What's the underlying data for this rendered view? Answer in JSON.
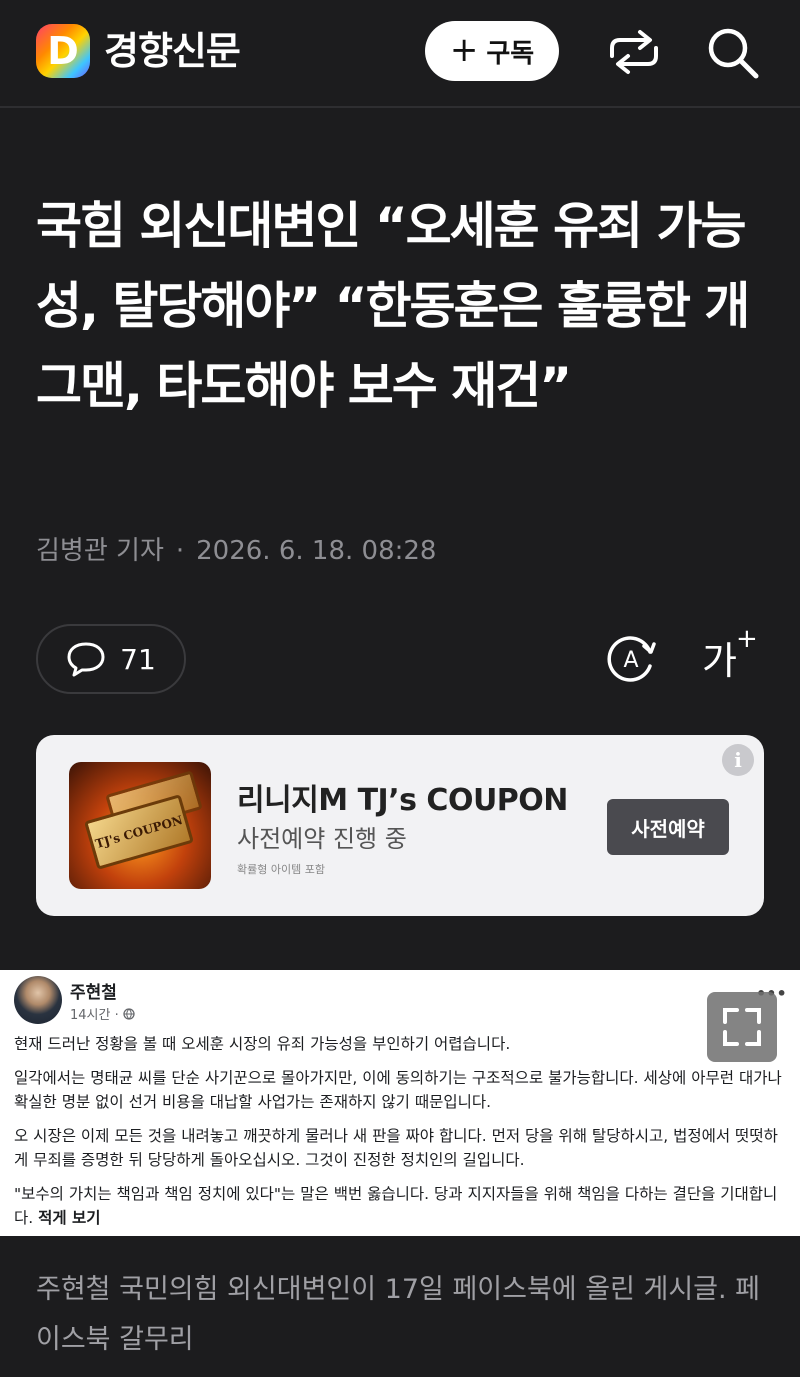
{
  "header": {
    "logo_letter": "D",
    "brand": "경향신문",
    "subscribe_plus": "+",
    "subscribe_label": "구독"
  },
  "article": {
    "title": "국힘 외신대변인 “오세훈 유죄 가능성, 탈당해야” “한동훈은 훌륭한 개그맨, 타도해야 보수 재건”",
    "author": "김병관 기자",
    "separator": "·",
    "date": "2026. 6. 18. 08:28",
    "comment_count": "71",
    "font_size_label": "가",
    "font_size_plus": "+"
  },
  "ad": {
    "title": "리니지M TJ’s COUPON",
    "subtitle": "사전예약 진행 중",
    "note": "확률형 아이템 포함",
    "cta": "사전예약",
    "info": "i",
    "coupon_text": "TJ's COUPON"
  },
  "post": {
    "name": "주현철",
    "time": "14시간 ·",
    "dots": "•••",
    "paragraphs": [
      "현재 드러난 정황을 볼 때 오세훈 시장의 유죄 가능성을 부인하기 어렵습니다.",
      "일각에서는 명태균 씨를 단순 사기꾼으로 몰아가지만, 이에 동의하기는 구조적으로 불가능합니다. 세상에 아무런 대가나 확실한 명분 없이 선거 비용을 대납할 사업가는 존재하지 않기 때문입니다.",
      "오 시장은 이제 모든 것을 내려놓고 깨끗하게 물러나 새 판을 짜야 합니다. 먼저 당을 위해 탈당하시고, 법정에서 떳떳하게 무죄를 증명한 뒤 당당하게 돌아오십시오. 그것이 진정한 정치인의 길입니다.",
      "\"보수의 가치는 책임과 책임 정치에 있다\"는 말은 백번 옳습니다. 당과 지지자들을 위해 책임을 다하는 결단을 기대합니다."
    ],
    "more": "적게 보기"
  },
  "caption": "주현철 국민의힘 외신대변인이 17일 페이스북에 올린 게시글. 페이스북 갈무리",
  "colors": {
    "background": "#1c1c1e",
    "ad_background": "#f2f2f4",
    "muted_text": "#8e8e93"
  }
}
